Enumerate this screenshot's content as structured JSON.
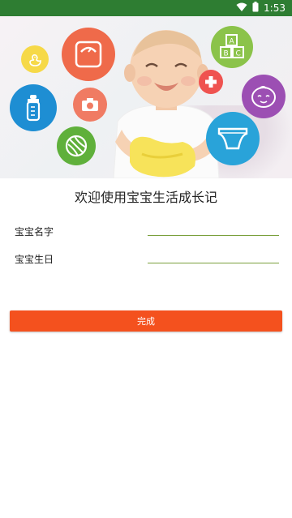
{
  "status_bar": {
    "time": "1:53"
  },
  "welcome_title": "欢迎使用宝宝生活成长记",
  "form": {
    "name_label": "宝宝名字",
    "name_value": "",
    "birthday_label": "宝宝生日",
    "birthday_value": ""
  },
  "done_button": "完成",
  "hero_icons": [
    "duck-icon",
    "scale-icon",
    "abc-blocks-icon",
    "baby-bottle-icon",
    "camera-icon",
    "medical-cross-icon",
    "baby-face-icon",
    "ball-icon",
    "diaper-icon"
  ],
  "colors": {
    "status_bar": "#2e7d32",
    "accent_button": "#f4511e",
    "input_underline": "#7aa03c"
  }
}
